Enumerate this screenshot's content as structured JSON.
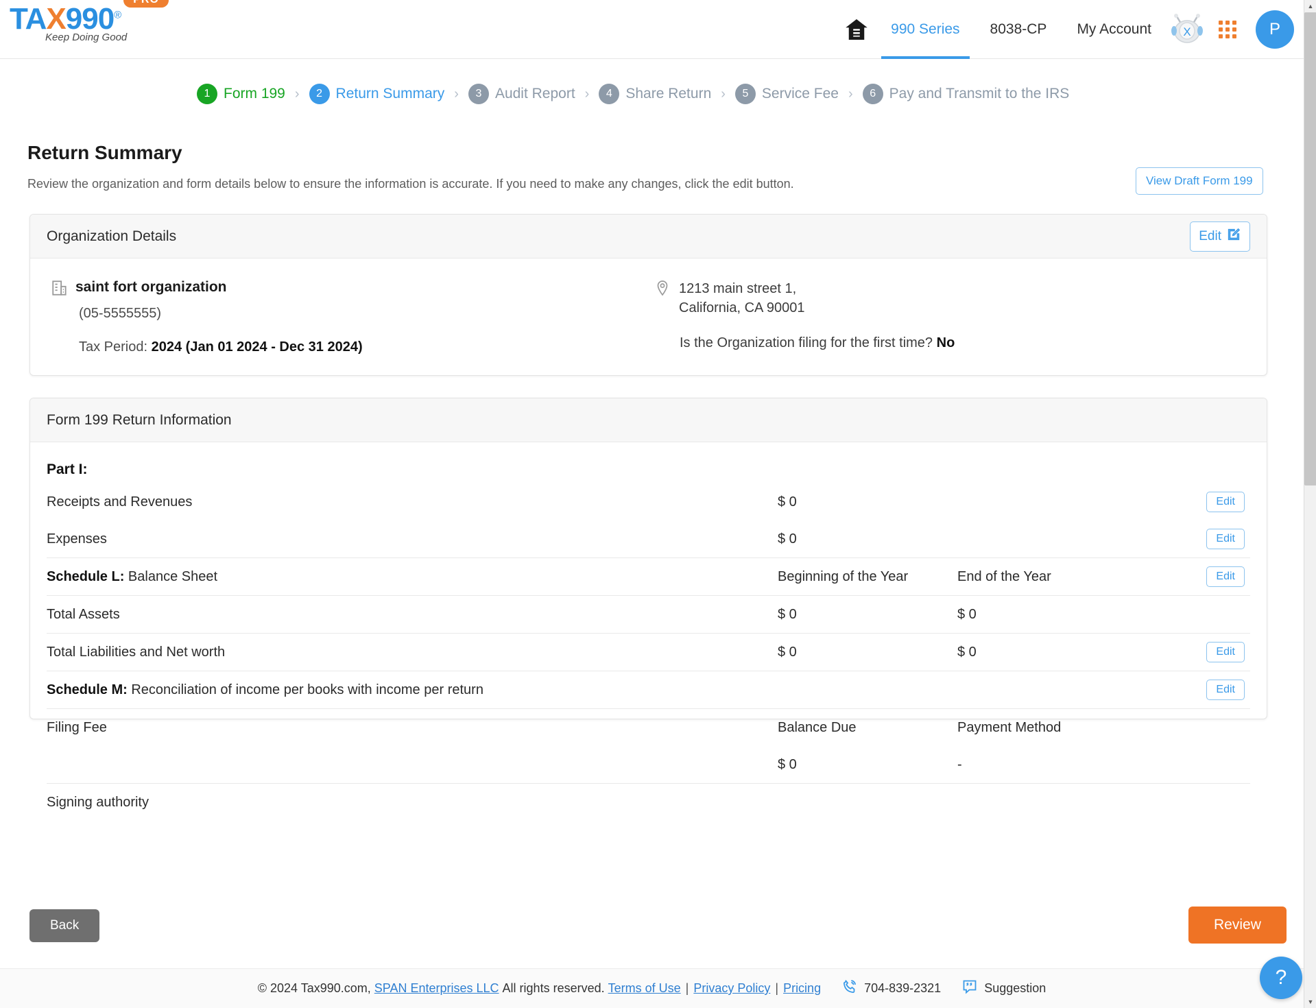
{
  "brand": {
    "name_tax": "TA",
    "name_x": "X",
    "name_990": "990",
    "registered": "®",
    "pro_badge": "PRO",
    "tagline": "Keep Doing Good"
  },
  "nav": {
    "home_icon": "home-icon",
    "items": [
      {
        "label": "990 Series",
        "active": true
      },
      {
        "label": "8038-CP",
        "active": false
      },
      {
        "label": "My Account",
        "active": false
      }
    ],
    "bot_icon": "chatbot-icon",
    "apps_icon": "apps-grid-icon",
    "avatar_initial": "P"
  },
  "stepper": {
    "steps": [
      {
        "num": "1",
        "label": "Form 199",
        "state": "done"
      },
      {
        "num": "2",
        "label": "Return Summary",
        "state": "current"
      },
      {
        "num": "3",
        "label": "Audit Report",
        "state": "todo"
      },
      {
        "num": "4",
        "label": "Share Return",
        "state": "todo"
      },
      {
        "num": "5",
        "label": "Service Fee",
        "state": "todo"
      },
      {
        "num": "6",
        "label": "Pay and Transmit to the IRS",
        "state": "todo"
      }
    ],
    "separator": "›"
  },
  "page": {
    "title": "Return Summary",
    "subtitle": "Review the organization and form details below to ensure the information is accurate. If you need to make any changes, click the edit button.",
    "view_draft_label": "View Draft Form 199"
  },
  "org_card": {
    "header": "Organization Details",
    "edit_label": "Edit",
    "name": "saint fort organization",
    "ein": "(05-5555555)",
    "tax_period_label": "Tax Period:",
    "tax_period_value": "2024 (Jan 01 2024 - Dec 31 2024)",
    "address_line1": "1213 main street 1,",
    "address_line2": "California, CA 90001",
    "first_time_label": "Is the Organization filing for the first time?",
    "first_time_value": "No"
  },
  "form_card": {
    "header": "Form 199 Return Information",
    "part_title": "Part I:",
    "edit_label": "Edit",
    "rows": [
      {
        "label": "Receipts and Revenues",
        "bold": false,
        "col_a": "$ 0",
        "col_b": "",
        "edit": true
      },
      {
        "label": "Expenses",
        "bold": false,
        "col_a": "$ 0",
        "col_b": "",
        "edit": true
      }
    ],
    "schedule_l": {
      "bold_prefix": "Schedule L:",
      "label": "Balance Sheet",
      "col_a_header": "Beginning of the Year",
      "col_b_header": "End of the Year",
      "edit": true,
      "rows": [
        {
          "label": "Total Assets",
          "col_a": "$ 0",
          "col_b": "$ 0",
          "edit": false
        },
        {
          "label": "Total Liabilities and Net worth",
          "col_a": "$ 0",
          "col_b": "$ 0",
          "edit": true
        }
      ]
    },
    "schedule_m": {
      "bold_prefix": "Schedule M:",
      "label": "Reconciliation of income per books with income per return",
      "edit": true
    },
    "filing_fee": {
      "label": "Filing Fee",
      "col_a_header": "Balance Due",
      "col_b_header": "Payment Method",
      "col_a_value": "$ 0",
      "col_b_value": "-"
    },
    "signing_authority": "Signing authority"
  },
  "actions": {
    "back_label": "Back",
    "review_label": "Review"
  },
  "footer": {
    "copyright": "© 2024 Tax990.com,",
    "company": "SPAN Enterprises LLC",
    "rights": "All rights reserved.",
    "terms": "Terms of Use",
    "privacy": "Privacy Policy",
    "pricing": "Pricing",
    "separator": "|",
    "phone": "704-839-2321",
    "suggestion": "Suggestion",
    "help_glyph": "?"
  },
  "colors": {
    "brand_blue": "#2a8fe0",
    "brand_orange": "#ef7f2f",
    "accent_blue": "#3a9ae8",
    "done_green": "#18a524",
    "todo_gray": "#8d9aa8",
    "review_orange": "#ef7325",
    "back_gray": "#6f6f6f"
  }
}
